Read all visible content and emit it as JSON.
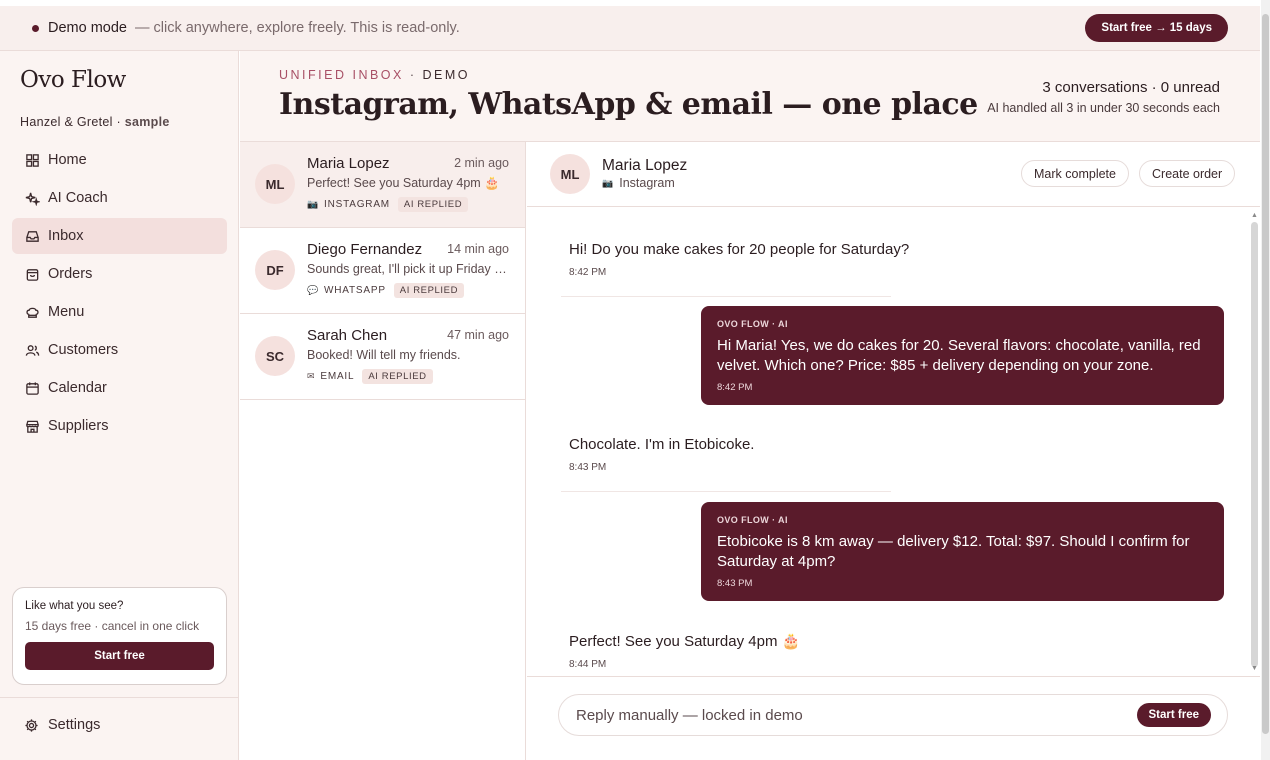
{
  "banner": {
    "mode_label": "Demo mode",
    "message": "— click anywhere, explore freely. This is read-only.",
    "cta_label": "Start free → 15 days"
  },
  "sidebar": {
    "brand": "Ovo Flow",
    "workspace_name": "Hanzel & Gretel",
    "workspace_sep": " · ",
    "workspace_tag": "sample",
    "items": [
      {
        "label": "Home",
        "icon": "grid-icon",
        "active": false
      },
      {
        "label": "AI Coach",
        "icon": "sparkle-icon",
        "active": false
      },
      {
        "label": "Inbox",
        "icon": "inbox-icon",
        "active": true
      },
      {
        "label": "Orders",
        "icon": "bag-icon",
        "active": false
      },
      {
        "label": "Menu",
        "icon": "chef-hat-icon",
        "active": false
      },
      {
        "label": "Customers",
        "icon": "users-icon",
        "active": false
      },
      {
        "label": "Calendar",
        "icon": "calendar-icon",
        "active": false
      },
      {
        "label": "Suppliers",
        "icon": "store-icon",
        "active": false
      }
    ],
    "promo": {
      "title": "Like what you see?",
      "subtitle": "15 days free · cancel in one click",
      "button": "Start free"
    },
    "settings_label": "Settings"
  },
  "header": {
    "kicker": "UNIFIED INBOX",
    "kicker_sep": " · ",
    "kicker_tag": "DEMO",
    "title": "Instagram, WhatsApp & email — one place",
    "stats_line": "3 conversations · 0 unread",
    "stats_sub": "AI handled all 3 in under 30 seconds each"
  },
  "conversations": [
    {
      "initials": "ML",
      "name": "Maria Lopez",
      "time": "2 min ago",
      "preview": "Perfect! See you Saturday 4pm 🎂",
      "channel": "INSTAGRAM",
      "channel_icon": "📷",
      "badge": "AI REPLIED",
      "selected": true
    },
    {
      "initials": "DF",
      "name": "Diego Fernandez",
      "time": "14 min ago",
      "preview": "Sounds great, I'll pick it up Friday …",
      "channel": "WHATSAPP",
      "channel_icon": "💬",
      "badge": "AI REPLIED",
      "selected": false
    },
    {
      "initials": "SC",
      "name": "Sarah Chen",
      "time": "47 min ago",
      "preview": "Booked! Will tell my friends.",
      "channel": "EMAIL",
      "channel_icon": "✉",
      "badge": "AI REPLIED",
      "selected": false
    }
  ],
  "thread": {
    "initials": "ML",
    "name": "Maria Lopez",
    "channel": "Instagram",
    "channel_icon": "📷",
    "mark_complete": "Mark complete",
    "create_order": "Create order",
    "messages": [
      {
        "dir": "in",
        "text": "Hi! Do you make cakes for 20 people for Saturday?",
        "time": "8:42 PM"
      },
      {
        "dir": "out",
        "label": "OVO FLOW · AI",
        "text": "Hi Maria! Yes, we do cakes for 20. Several flavors: chocolate, vanilla, red velvet. Which one? Price: $85 + delivery depending on your zone.",
        "time": "8:42 PM"
      },
      {
        "dir": "in",
        "text": "Chocolate. I'm in Etobicoke.",
        "time": "8:43 PM"
      },
      {
        "dir": "out",
        "label": "OVO FLOW · AI",
        "text": "Etobicoke is 8 km away — delivery $12. Total: $97. Should I confirm for Saturday at 4pm?",
        "time": "8:43 PM"
      },
      {
        "dir": "in",
        "text": "Perfect! See you Saturday 4pm 🎂",
        "time": "8:44 PM"
      }
    ],
    "composer_placeholder": "Reply manually — locked in demo",
    "composer_button": "Start free"
  },
  "colors": {
    "brand": "#5a1b2b",
    "accent": "#a85066",
    "sidebar_bg": "#fbf4f2",
    "active_bg": "#f3dfdd"
  }
}
